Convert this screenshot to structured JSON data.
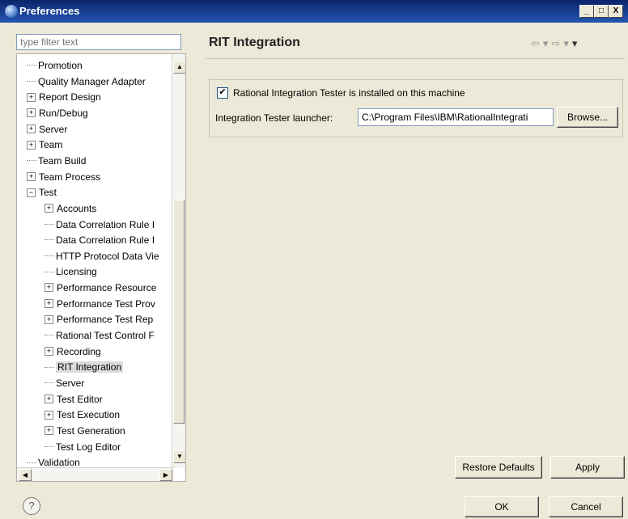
{
  "window": {
    "title": "Preferences",
    "controls": [
      "_",
      "□",
      "X"
    ]
  },
  "filter": {
    "placeholder": "type filter text",
    "value": ""
  },
  "tree": {
    "items": [
      {
        "label": "Promotion",
        "level": 0,
        "expandable": false,
        "selected": false
      },
      {
        "label": "Quality Manager Adapter",
        "level": 0,
        "expandable": false,
        "selected": false
      },
      {
        "label": "Report Design",
        "level": 0,
        "expandable": true,
        "selected": false
      },
      {
        "label": "Run/Debug",
        "level": 0,
        "expandable": true,
        "selected": false
      },
      {
        "label": "Server",
        "level": 0,
        "expandable": true,
        "selected": false
      },
      {
        "label": "Team",
        "level": 0,
        "expandable": true,
        "selected": false
      },
      {
        "label": "Team Build",
        "level": 0,
        "expandable": false,
        "selected": false
      },
      {
        "label": "Team Process",
        "level": 0,
        "expandable": true,
        "selected": false
      },
      {
        "label": "Test",
        "level": 0,
        "expandable": true,
        "expanded": true,
        "selected": false
      },
      {
        "label": "Accounts",
        "level": 1,
        "expandable": true,
        "selected": false
      },
      {
        "label": "Data Correlation Rule I",
        "level": 1,
        "expandable": false,
        "selected": false
      },
      {
        "label": "Data Correlation Rule I",
        "level": 1,
        "expandable": false,
        "selected": false
      },
      {
        "label": "HTTP Protocol Data Vie",
        "level": 1,
        "expandable": false,
        "selected": false
      },
      {
        "label": "Licensing",
        "level": 1,
        "expandable": false,
        "selected": false
      },
      {
        "label": "Performance Resource",
        "level": 1,
        "expandable": true,
        "selected": false
      },
      {
        "label": "Performance Test Prov",
        "level": 1,
        "expandable": true,
        "selected": false
      },
      {
        "label": "Performance Test Rep",
        "level": 1,
        "expandable": true,
        "selected": false
      },
      {
        "label": "Rational Test Control F",
        "level": 1,
        "expandable": false,
        "selected": false
      },
      {
        "label": "Recording",
        "level": 1,
        "expandable": true,
        "selected": false
      },
      {
        "label": "RIT Integration",
        "level": 1,
        "expandable": false,
        "selected": true
      },
      {
        "label": "Server",
        "level": 1,
        "expandable": false,
        "selected": false
      },
      {
        "label": "Test Editor",
        "level": 1,
        "expandable": true,
        "selected": false
      },
      {
        "label": "Test Execution",
        "level": 1,
        "expandable": true,
        "selected": false
      },
      {
        "label": "Test Generation",
        "level": 1,
        "expandable": true,
        "selected": false
      },
      {
        "label": "Test Log Editor",
        "level": 1,
        "expandable": false,
        "selected": false
      },
      {
        "label": "Validation",
        "level": 0,
        "expandable": false,
        "selected": false
      }
    ]
  },
  "page": {
    "title": "RIT Integration",
    "nav_icons": [
      "back-arrow-icon",
      "dropdown-icon",
      "forward-arrow-icon",
      "dropdown-icon",
      "view-menu-icon"
    ],
    "checkbox": {
      "label": "Rational Integration Tester is installed on this machine",
      "checked": true
    },
    "launcher": {
      "label": "Integration Tester launcher:",
      "value": "C:\\Program Files\\IBM\\RationalIntegrati",
      "browse_label": "Browse..."
    },
    "restore_label": "Restore Defaults",
    "apply_label": "Apply"
  },
  "footer": {
    "help_icon": "help-icon",
    "ok_label": "OK",
    "cancel_label": "Cancel"
  }
}
